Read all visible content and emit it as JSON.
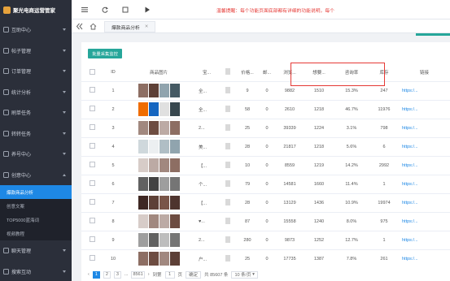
{
  "app": {
    "title": "聚光电商运营管家"
  },
  "sidebar": {
    "items": [
      {
        "label": "互助中心",
        "icon": "help-icon"
      },
      {
        "label": "帖子管理",
        "icon": "post-icon"
      },
      {
        "label": "订单管理",
        "icon": "order-icon"
      },
      {
        "label": "统计分析",
        "icon": "stats-icon"
      },
      {
        "label": "刷单任务",
        "icon": "task-icon"
      },
      {
        "label": "转转任务",
        "icon": "transfer-icon"
      },
      {
        "label": "养号中心",
        "icon": "account-icon"
      },
      {
        "label": "创意中心",
        "icon": "creative-icon"
      }
    ],
    "submenu": [
      {
        "label": "爆款商品分析",
        "active": true
      },
      {
        "label": "创意文案",
        "active": false
      },
      {
        "label": "TOP5000蓝海词",
        "active": false
      },
      {
        "label": "视频教程",
        "active": false
      }
    ],
    "after": [
      {
        "label": "聊天管理",
        "icon": "chat-icon"
      },
      {
        "label": "搜索互动",
        "icon": "search-icon"
      }
    ]
  },
  "topbar": {
    "notice": "温馨提醒：每个功能页面底部都有详细的功能说明，每个"
  },
  "tabs": {
    "active": "爆款商品分析"
  },
  "toolbar": {
    "batch_button": "批量采集监控"
  },
  "table": {
    "headers": [
      "ID",
      "商品图片",
      "宝...",
      "",
      "价格...",
      "邮...",
      "浏览...",
      "想要...",
      "咨询率",
      "库存",
      "链接"
    ],
    "rows": [
      {
        "id": "1",
        "title": "全...",
        "price": "9",
        "mail": "0",
        "views": "9882",
        "wants": "1510",
        "rate": "15.3%",
        "stock": "247",
        "link": "https:/..."
      },
      {
        "id": "2",
        "title": "全...",
        "price": "58",
        "mail": "0",
        "views": "2610",
        "wants": "1218",
        "rate": "46.7%",
        "stock": "11976",
        "link": "https:/..."
      },
      {
        "id": "3",
        "title": "2...",
        "price": "25",
        "mail": "0",
        "views": "39339",
        "wants": "1224",
        "rate": "3.1%",
        "stock": "798",
        "link": "https:/..."
      },
      {
        "id": "4",
        "title": "美...",
        "price": "28",
        "mail": "0",
        "views": "21817",
        "wants": "1218",
        "rate": "5.6%",
        "stock": "6",
        "link": "https:/..."
      },
      {
        "id": "5",
        "title": "【...",
        "price": "10",
        "mail": "0",
        "views": "8559",
        "wants": "1219",
        "rate": "14.2%",
        "stock": "2992",
        "link": "https:/..."
      },
      {
        "id": "6",
        "title": "个...",
        "price": "79",
        "mail": "0",
        "views": "14581",
        "wants": "1660",
        "rate": "11.4%",
        "stock": "1",
        "link": "https:/..."
      },
      {
        "id": "7",
        "title": "【...",
        "price": "28",
        "mail": "0",
        "views": "13129",
        "wants": "1436",
        "rate": "10.9%",
        "stock": "19974",
        "link": "https:/..."
      },
      {
        "id": "8",
        "title": "♥...",
        "price": "87",
        "mail": "0",
        "views": "15558",
        "wants": "1240",
        "rate": "8.0%",
        "stock": "975",
        "link": "https:/..."
      },
      {
        "id": "9",
        "title": "2...",
        "price": "280",
        "mail": "0",
        "views": "9873",
        "wants": "1252",
        "rate": "12.7%",
        "stock": "1",
        "link": "https:/..."
      },
      {
        "id": "10",
        "title": "户...",
        "price": "25",
        "mail": "0",
        "views": "17735",
        "wants": "1387",
        "rate": "7.8%",
        "stock": "261",
        "link": "https:/..."
      }
    ]
  },
  "pager": {
    "pages": [
      "1",
      "2",
      "3",
      "...",
      "8561"
    ],
    "goto_label": "到第",
    "goto_value": "1",
    "page_suffix": "页",
    "confirm": "确定",
    "total": "共 85607 条",
    "per_page": "10 条/页"
  }
}
